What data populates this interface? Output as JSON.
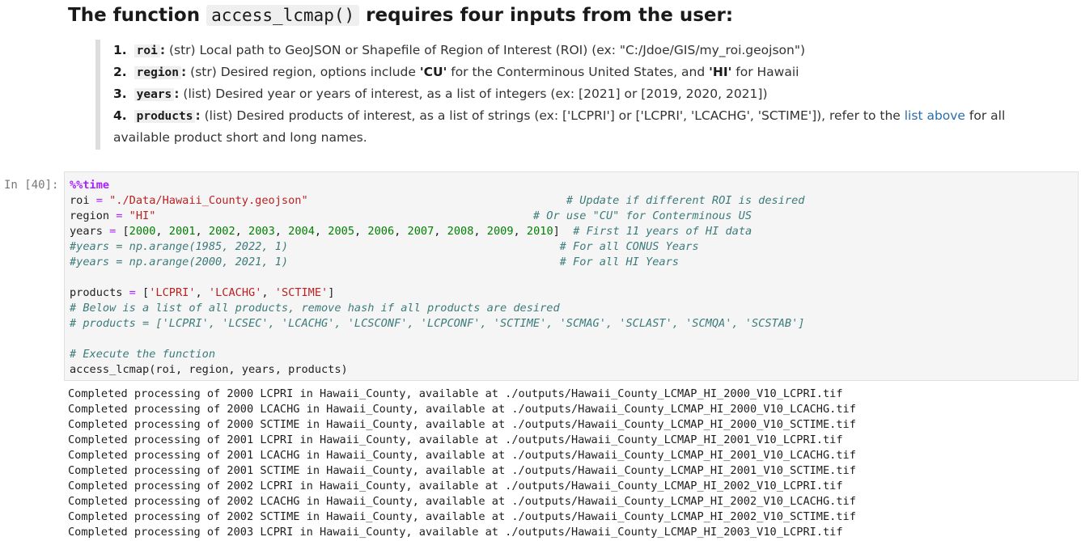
{
  "markdown": {
    "heading_prefix": "The function ",
    "heading_code": "access_lcmap()",
    "heading_suffix": " requires four inputs from the user:",
    "items": [
      {
        "num": "1.",
        "code": "roi",
        "colon": ":",
        "text": " (str) Local path to GeoJSON or Shapefile of Region of Interest (ROI) (ex: \"C:/Jdoe/GIS/my_roi.geojson\")"
      },
      {
        "num": "2.",
        "code": "region",
        "colon": ":",
        "text_a": " (str) Desired region, options include ",
        "bold_a": "'CU'",
        "text_b": " for the Conterminous United States, and ",
        "bold_b": "'HI'",
        "text_c": " for Hawaii"
      },
      {
        "num": "3.",
        "code": "years",
        "colon": ":",
        "text": " (list) Desired year or years of interest, as a list of integers (ex: [2021] or [2019, 2020, 2021])"
      },
      {
        "num": "4.",
        "code": "products",
        "colon": ":",
        "text_a": " (list) Desired products of interest, as a list of strings (ex: ['LCPRI'] or ['LCPRI', 'LCACHG', 'SCTIME']), refer to the ",
        "link": "list above",
        "text_b": " for all available product short and long names."
      }
    ]
  },
  "cell": {
    "prompt": "In [40]:",
    "code": {
      "magic": "%%time",
      "roi_var": "roi",
      "eq": " = ",
      "roi_val": "\"./Data/Hawaii_County.geojson\"",
      "roi_pad": "                                       ",
      "roi_comment": "# Update if different ROI is desired",
      "region_var": "region",
      "region_val": "\"HI\"",
      "region_pad": "                                                         ",
      "region_comment": "# Or use \"CU\" for Conterminous US",
      "years_var": "years",
      "years_open": "[",
      "years_nums": [
        "2000",
        "2001",
        "2002",
        "2003",
        "2004",
        "2005",
        "2006",
        "2007",
        "2008",
        "2009",
        "2010"
      ],
      "years_close": "]",
      "years_pad": "  ",
      "years_comment": "# First 11 years of HI data",
      "alt1": "#years = np.arange(1985, 2022, 1)",
      "alt1_pad": "                                         ",
      "alt1_comment": "# For all CONUS Years",
      "alt2": "#years = np.arange(2000, 2021, 1)",
      "alt2_pad": "                                         ",
      "alt2_comment": "# For all HI Years",
      "products_var": "products",
      "products_list": [
        "'LCPRI'",
        "'LCACHG'",
        "'SCTIME'"
      ],
      "products_note": "# Below is a list of all products, remove hash if all products are desired",
      "products_all": "# products = ['LCPRI', 'LCSEC', 'LCACHG', 'LCSCONF', 'LCPCONF', 'SCTIME', 'SCMAG', 'SCLAST', 'SCMQA', 'SCSTAB']",
      "exec_comment": "# Execute the function",
      "call": "access_lcmap(roi, region, years, products)"
    }
  },
  "output": {
    "lines": [
      "Completed processing of 2000 LCPRI in Hawaii_County, available at ./outputs/Hawaii_County_LCMAP_HI_2000_V10_LCPRI.tif",
      "Completed processing of 2000 LCACHG in Hawaii_County, available at ./outputs/Hawaii_County_LCMAP_HI_2000_V10_LCACHG.tif",
      "Completed processing of 2000 SCTIME in Hawaii_County, available at ./outputs/Hawaii_County_LCMAP_HI_2000_V10_SCTIME.tif",
      "Completed processing of 2001 LCPRI in Hawaii_County, available at ./outputs/Hawaii_County_LCMAP_HI_2001_V10_LCPRI.tif",
      "Completed processing of 2001 LCACHG in Hawaii_County, available at ./outputs/Hawaii_County_LCMAP_HI_2001_V10_LCACHG.tif",
      "Completed processing of 2001 SCTIME in Hawaii_County, available at ./outputs/Hawaii_County_LCMAP_HI_2001_V10_SCTIME.tif",
      "Completed processing of 2002 LCPRI in Hawaii_County, available at ./outputs/Hawaii_County_LCMAP_HI_2002_V10_LCPRI.tif",
      "Completed processing of 2002 LCACHG in Hawaii_County, available at ./outputs/Hawaii_County_LCMAP_HI_2002_V10_LCACHG.tif",
      "Completed processing of 2002 SCTIME in Hawaii_County, available at ./outputs/Hawaii_County_LCMAP_HI_2002_V10_SCTIME.tif",
      "Completed processing of 2003 LCPRI in Hawaii_County, available at ./outputs/Hawaii_County_LCMAP_HI_2003_V10_LCPRI.tif"
    ]
  }
}
